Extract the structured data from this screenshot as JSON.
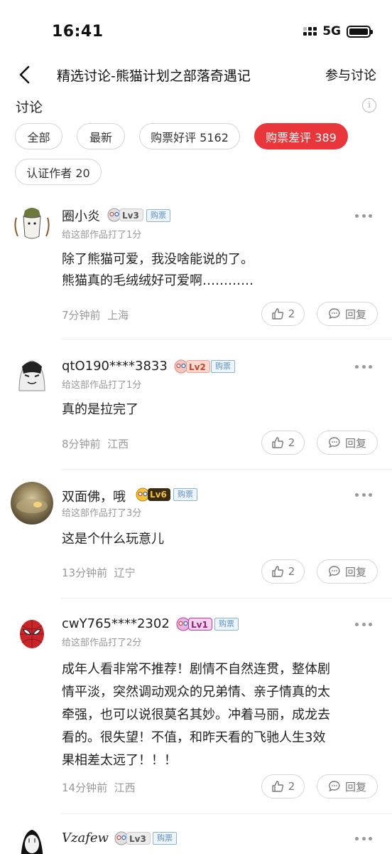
{
  "status_bar": {
    "time": "16:41",
    "network": "5G"
  },
  "header": {
    "title": "精选讨论-熊猫计划之部落奇遇记",
    "join_label": "参与讨论",
    "section_label": "讨论"
  },
  "filters": [
    {
      "label": "全部",
      "active": false
    },
    {
      "label": "最新",
      "active": false
    },
    {
      "label": "购票好评 5162",
      "active": false
    },
    {
      "label": "购票差评 389",
      "active": true
    },
    {
      "label": "认证作者 20",
      "active": false
    }
  ],
  "comments": [
    {
      "username": "圈小炎",
      "level": "Lv3",
      "ticket_tag": "购票",
      "rated": "给这部作品打了1分",
      "lines": [
        "除了熊猫可爱，我没啥能说的了。",
        "熊猫真的毛绒绒好可爱啊…………"
      ],
      "time": "7分钟前",
      "location": "上海",
      "likes": "2",
      "reply_label": "回复"
    },
    {
      "username": "qtO190****3833",
      "level": "Lv2",
      "ticket_tag": "购票",
      "rated": "给这部作品打了1分",
      "lines": [
        "真的是拉完了"
      ],
      "time": "8分钟前",
      "location": "江西",
      "likes": "2",
      "reply_label": "回复"
    },
    {
      "username": "双面佛，哦",
      "level": "Lv6",
      "ticket_tag": "购票",
      "rated": "给这部作品打了3分",
      "lines": [
        "这是个什么玩意儿"
      ],
      "time": "13分钟前",
      "location": "辽宁",
      "likes": "2",
      "reply_label": "回复"
    },
    {
      "username": "cwY765****2302",
      "level": "Lv1",
      "ticket_tag": "购票",
      "rated": "给这部作品打了2分",
      "lines": [
        "成年人看非常不推荐！剧情不自然连贯，整体剧",
        "情平淡，突然调动观众的兄弟情、亲子情真的太",
        "牵强，也可以说很莫名其妙。冲着马丽，成龙去",
        "看的。很失望！不值，和昨天看的飞驰人生3效",
        "果相差太远了！！！"
      ],
      "time": "14分钟前",
      "location": "江西",
      "likes": "2",
      "reply_label": "回复"
    },
    {
      "username": "Vzafew",
      "level": "Lv3",
      "ticket_tag": "购票"
    }
  ],
  "colors": {
    "accent": "#e8363a",
    "lv1": "#c03aa8",
    "lv2": "#f0a090",
    "lv3": "#d7d7d7",
    "lv6": "#3a2a10"
  },
  "icons": [
    "back-arrow-icon",
    "info-icon",
    "more-icon",
    "thumbs-up-icon",
    "comment-bubble-icon",
    "level-face-icon"
  ]
}
